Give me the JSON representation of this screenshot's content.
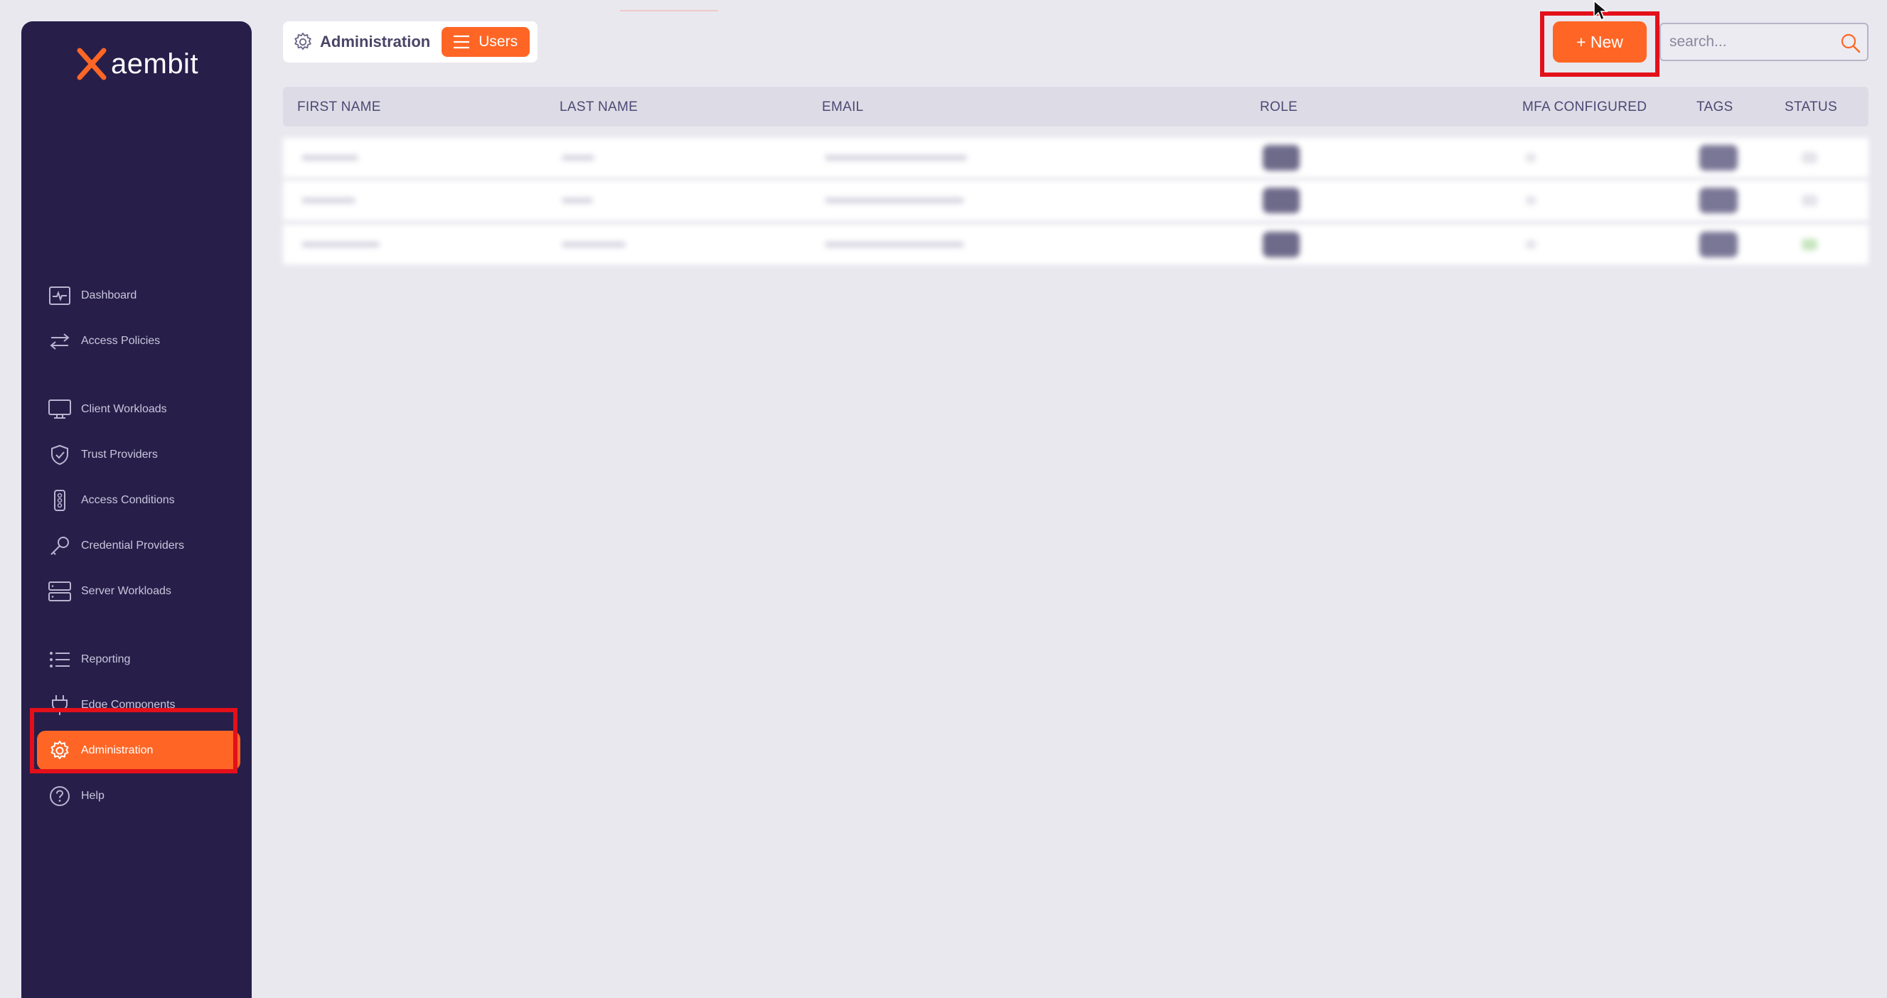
{
  "app": {
    "logo_text": "aembit",
    "brand_color": "#ff6625",
    "sidebar_color": "#271f4a"
  },
  "sidebar": {
    "items": [
      {
        "label": "Dashboard",
        "icon": "activity-icon"
      },
      {
        "label": "Access Policies",
        "icon": "arrows-exchange-icon"
      },
      {
        "label": "Client Workloads",
        "icon": "monitor-icon"
      },
      {
        "label": "Trust Providers",
        "icon": "shield-check-icon"
      },
      {
        "label": "Access Conditions",
        "icon": "traffic-light-icon"
      },
      {
        "label": "Credential Providers",
        "icon": "key-icon"
      },
      {
        "label": "Server Workloads",
        "icon": "server-icon"
      },
      {
        "label": "Reporting",
        "icon": "list-icon"
      },
      {
        "label": "Edge Components",
        "icon": "plug-icon"
      },
      {
        "label": "Administration",
        "icon": "gear-icon",
        "active": true
      },
      {
        "label": "Help",
        "icon": "help-circle-icon"
      }
    ]
  },
  "header": {
    "breadcrumb_root": "Administration",
    "breadcrumb_current": "Users",
    "new_button": "+ New",
    "search_placeholder": "search..."
  },
  "table": {
    "columns": [
      "FIRST NAME",
      "LAST NAME",
      "EMAIL",
      "ROLE",
      "MFA CONFIGURED",
      "TAGS",
      "STATUS"
    ],
    "rows_note_hidden": true
  }
}
